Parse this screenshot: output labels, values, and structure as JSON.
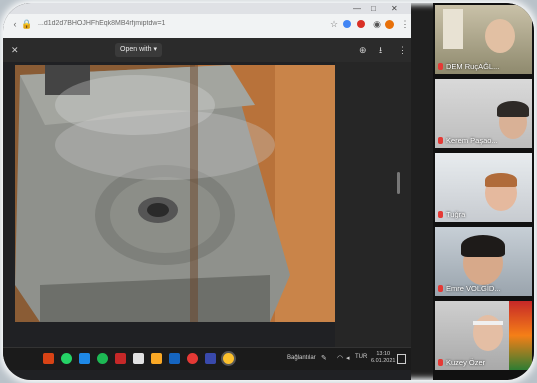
{
  "browser": {
    "url": "...d1d2d7BHOJHFhEqk8MB4rfjmiptdw=1",
    "window_controls": [
      "—",
      "□",
      "✕"
    ]
  },
  "viewer": {
    "open_with_label": "Open with ▾"
  },
  "taskbar": {
    "search_label": "Bağlantılar",
    "language": "TUR",
    "time": "13:10",
    "date": "6.01.2021"
  },
  "participants": [
    {
      "name": "DEM RuçAĞL..."
    },
    {
      "name": "Kerem Paşao..."
    },
    {
      "name": "Tuğra"
    },
    {
      "name": "Emre VOLGİD..."
    },
    {
      "name": "Kuzey Özer"
    }
  ]
}
